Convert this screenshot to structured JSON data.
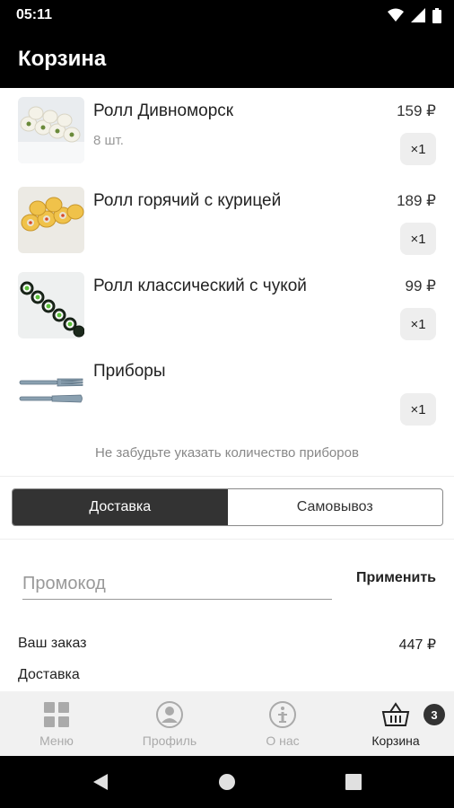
{
  "status_bar": {
    "time": "05:11",
    "icons": [
      "wifi-icon",
      "signal-icon",
      "battery-icon"
    ]
  },
  "app_bar": {
    "title": "Корзина"
  },
  "cart": {
    "items": [
      {
        "name": "Ролл Дивноморск",
        "subtitle": "8 шт.",
        "price": "159 ₽",
        "quantity": "×1",
        "thumb": "roll-image-white"
      },
      {
        "name": "Ролл горячий с курицей",
        "subtitle": "",
        "price": "189 ₽",
        "quantity": "×1",
        "thumb": "roll-image-baked"
      },
      {
        "name": "Ролл классический с чукой",
        "subtitle": "",
        "price": "99 ₽",
        "quantity": "×1",
        "thumb": "roll-image-seaweed"
      },
      {
        "name": "Приборы",
        "subtitle": "",
        "price": "",
        "quantity": "×1",
        "thumb": "cutlery-image"
      }
    ],
    "hint": "Не забудьте указать количество приборов"
  },
  "delivery_toggle": {
    "options": [
      "Доставка",
      "Самовывоз"
    ],
    "selected": "Доставка"
  },
  "promo": {
    "placeholder": "Промокод",
    "value": "",
    "apply_label": "Применить"
  },
  "summary": {
    "order_label": "Ваш заказ",
    "order_value": "447 ₽",
    "delivery_label": "Доставка"
  },
  "bottom_nav": {
    "items": [
      {
        "label": "Меню",
        "icon": "grid-icon",
        "active": false
      },
      {
        "label": "Профиль",
        "icon": "profile-icon",
        "active": false
      },
      {
        "label": "О нас",
        "icon": "info-icon",
        "active": false
      },
      {
        "label": "Корзина",
        "icon": "basket-icon",
        "active": true
      }
    ],
    "cart_badge": "3"
  },
  "system_nav": [
    "back-icon",
    "home-icon",
    "recents-icon"
  ],
  "colors": {
    "app_bar": "#000000",
    "active_toggle": "#333333",
    "nav_background": "#f1f1f1",
    "muted_text": "#999999"
  }
}
